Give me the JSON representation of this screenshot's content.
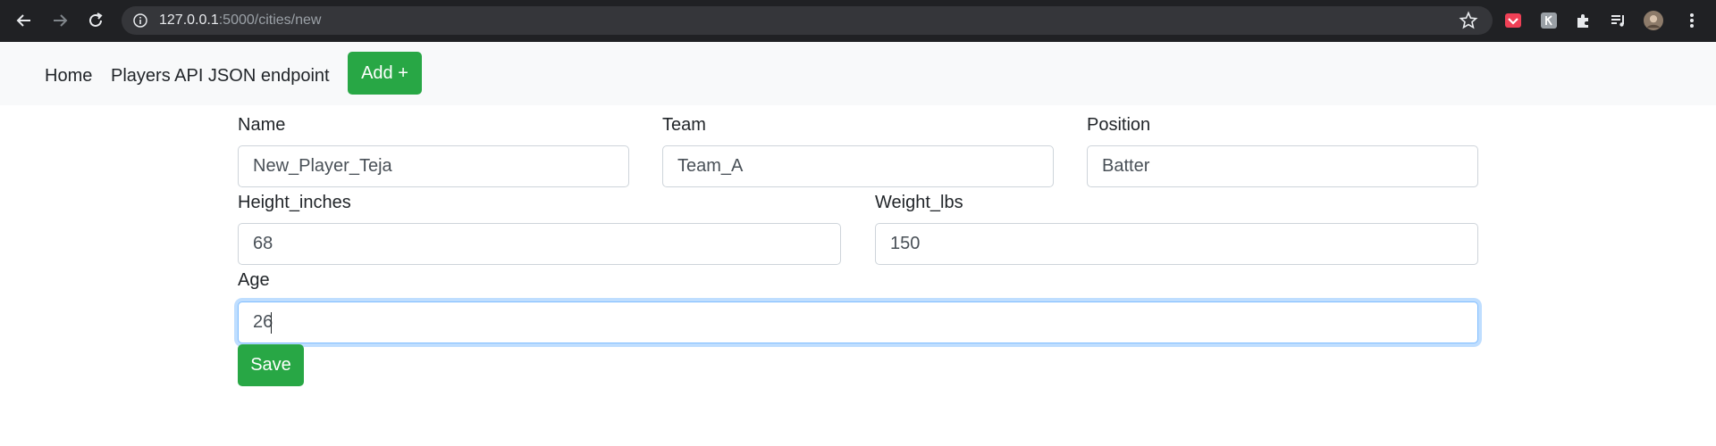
{
  "browser": {
    "url_host": "127.0.0.1",
    "url_path": ":5000/cities/new",
    "icons": [
      "back-icon",
      "forward-icon",
      "reload-icon",
      "info-icon",
      "star-icon",
      "pocket-icon",
      "extension-k-icon",
      "puzzle-icon",
      "media-queue-icon",
      "profile-avatar",
      "kebab-menu-icon"
    ]
  },
  "navbar": {
    "home_label": "Home",
    "api_label": "Players API JSON endpoint",
    "add_label": "Add +"
  },
  "form": {
    "name": {
      "label": "Name",
      "value": "New_Player_Teja"
    },
    "team": {
      "label": "Team",
      "value": "Team_A"
    },
    "position": {
      "label": "Position",
      "value": "Batter"
    },
    "height": {
      "label": "Height_inches",
      "value": "68"
    },
    "weight": {
      "label": "Weight_lbs",
      "value": "150"
    },
    "age": {
      "label": "Age",
      "value": "26"
    },
    "save_label": "Save"
  },
  "colors": {
    "success": "#28a745",
    "chrome_bg": "#202124",
    "navbar_bg": "#f8f9fa",
    "focus_border": "#80bdff"
  }
}
